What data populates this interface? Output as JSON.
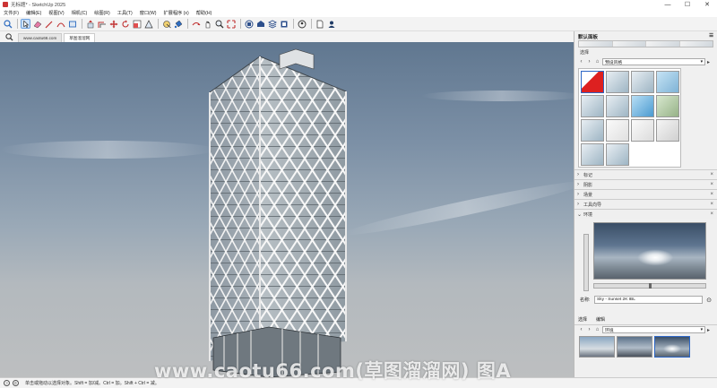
{
  "window": {
    "title": "无标题* - SketchUp 2025",
    "minimize": "—",
    "maximize": "☐",
    "close": "✕"
  },
  "menu": [
    "文件(F)",
    "编辑(E)",
    "视图(V)",
    "相机(C)",
    "绘图(R)",
    "工具(T)",
    "窗口(W)",
    "扩展程序 (x)",
    "帮助(H)"
  ],
  "tabs": [
    {
      "label": "www.caotu66.com",
      "active": false
    },
    {
      "label": "草图溜溜网",
      "active": true
    }
  ],
  "panel": {
    "title": "默认面板",
    "styles_sub": "选择",
    "style_collection": "预设风格",
    "trays": [
      {
        "label": "标记",
        "collapsed": true
      },
      {
        "label": "阴影",
        "collapsed": true
      },
      {
        "label": "场景",
        "collapsed": true
      },
      {
        "label": "工具向导",
        "collapsed": true
      },
      {
        "label": "环境",
        "collapsed": false
      }
    ],
    "env_name_label": "名称:",
    "env_name_value": "Sky - Sunset 2K IBL",
    "env_tabs": [
      "选择",
      "编辑"
    ],
    "env_collection": "环境"
  },
  "status": {
    "text": "单击或拖动以选择对象。Shift = 加/减。Ctrl = 加。Shift + Ctrl = 减。"
  },
  "watermark": "www.caotu66.com(草图溜溜网) 图A",
  "colors": {
    "accent": "#2c66c6",
    "sky_top": "#607790",
    "sky_bottom": "#bdbfc0"
  }
}
